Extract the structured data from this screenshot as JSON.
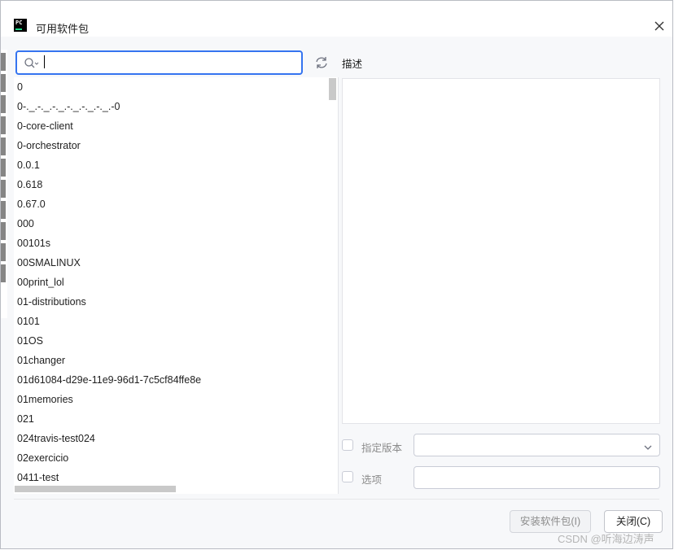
{
  "window": {
    "title": "可用软件包"
  },
  "search": {
    "value": "",
    "placeholder": ""
  },
  "packages": [
    "0",
    "0-._.-._.-._.-._.-._.-._.-0",
    "0-core-client",
    "0-orchestrator",
    "0.0.1",
    "0.618",
    "0.67.0",
    "000",
    "00101s",
    "00SMALINUX",
    "00print_lol",
    "01-distributions",
    "0101",
    "01OS",
    "01changer",
    "01d61084-d29e-11e9-96d1-7c5cf84ffe8e",
    "01memories",
    "021",
    "024travis-test024",
    "02exercicio",
    "0411-test"
  ],
  "description": {
    "label": "描述",
    "text": ""
  },
  "options": {
    "specify_version_label": "指定版本",
    "specify_version_checked": false,
    "version_value": "",
    "options_label": "选项",
    "options_checked": false,
    "options_value": ""
  },
  "buttons": {
    "install": "安装软件包(I)",
    "close": "关闭(C)"
  },
  "watermark": "CSDN @听海边涛声",
  "icons": {
    "app": "pycharm-icon",
    "close": "close-icon",
    "search": "search-icon",
    "refresh": "refresh-icon",
    "dropdown": "chevron-down-icon"
  },
  "colors": {
    "accent": "#3574f0",
    "background": "#f7f8fa"
  }
}
